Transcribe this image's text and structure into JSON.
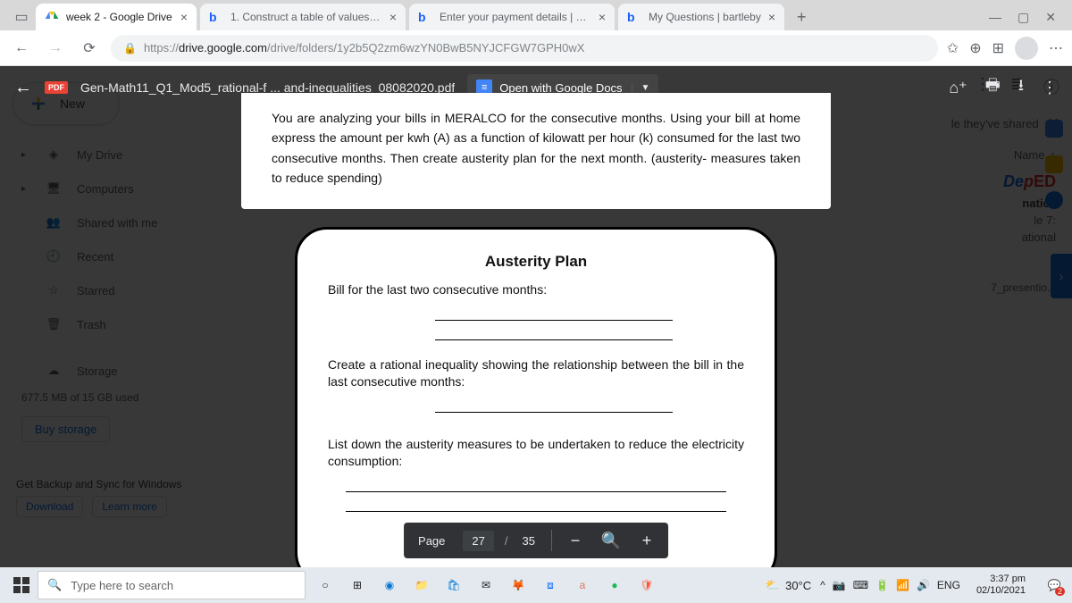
{
  "tabs": [
    {
      "title": "week 2 - Google Drive",
      "active": true
    },
    {
      "title": "1. Construct a table of values of …",
      "active": false
    },
    {
      "title": "Enter your payment details | bart…",
      "active": false
    },
    {
      "title": "My Questions | bartleby",
      "active": false
    }
  ],
  "toolbar": {
    "url_prefix": "https://",
    "url_host": "drive.google.com",
    "url_path": "/drive/folders/1y2b5Q2zm6wzYN0BwB5NYJCFGW7GPH0wX"
  },
  "sidebar": {
    "new": "New",
    "items": [
      {
        "label": "My Drive",
        "expand": true
      },
      {
        "label": "Computers",
        "expand": true
      },
      {
        "label": "Shared with me",
        "expand": false
      },
      {
        "label": "Recent",
        "expand": false
      },
      {
        "label": "Starred",
        "expand": false
      },
      {
        "label": "Trash",
        "expand": false
      }
    ],
    "storage_label": "Storage",
    "storage_used": "677.5 MB of 15 GB used",
    "buy": "Buy storage",
    "backup_title": "Get Backup and Sync for Windows",
    "download": "Download",
    "learn": "Learn more"
  },
  "right": {
    "shared_banner": "le they've shared",
    "sort": "Name",
    "deped": "DepED",
    "line1": "natics",
    "line2": "le 7:",
    "line3": "ational",
    "file": "7_presentio..."
  },
  "pdf": {
    "filename": "Gen-Math11_Q1_Mod5_rational-f ... and-inequalities_08082020.pdf",
    "open_with": "Open with Google Docs",
    "problem": "You are analyzing your bills in MERALCO for the consecutive months. Using your bill at home express the amount per kwh (A) as a function of kilowatt per hour (k) consumed for the last two consecutive months. Then create austerity plan for the next month. (austerity- measures taken to reduce spending)",
    "card_title": "Austerity Plan",
    "card_p1": "Bill for the last two consecutive months:",
    "card_p2": "Create a rational inequality showing the relationship between the bill in the last consecutive months:",
    "card_p3": "List down the austerity measures to be undertaken to reduce the electricity consumption:",
    "page_label": "Page",
    "page_current": "27",
    "page_sep": "/",
    "page_total": "35"
  },
  "taskbar": {
    "search_placeholder": "Type here to search",
    "temp": "30°C",
    "lang": "ENG",
    "time": "3:37 pm",
    "date": "02/10/2021",
    "notif_count": "2"
  }
}
